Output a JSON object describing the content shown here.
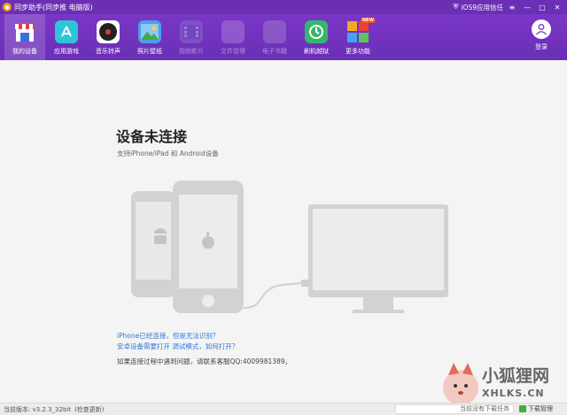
{
  "titlebar": {
    "title": "同步助手(同步推 电脑版)",
    "trust_label": "iOS9应用信任",
    "minimize": "—",
    "maximize": "□",
    "close": "✕"
  },
  "nav": {
    "items": [
      {
        "label": "我的设备",
        "icon": "device-icon"
      },
      {
        "label": "应用游戏",
        "icon": "app-store-icon"
      },
      {
        "label": "音乐铃声",
        "icon": "music-icon"
      },
      {
        "label": "照片壁纸",
        "icon": "photo-icon"
      },
      {
        "label": "视频影片",
        "icon": "video-icon"
      },
      {
        "label": "文件管理",
        "icon": "folder-icon"
      },
      {
        "label": "电子书籍",
        "icon": "book-icon"
      },
      {
        "label": "刷机越狱",
        "icon": "flash-icon"
      },
      {
        "label": "更多功能",
        "icon": "more-icon"
      }
    ],
    "new_badge": "NEW",
    "login_label": "登录"
  },
  "main": {
    "heading": "设备未连接",
    "subheading": "支持iPhone/iPad 和 Android设备",
    "link1": "iPhone已经连接，但是无法识别？",
    "link2": "安卓设备需要打开 调试模式，如何打开？",
    "note": "如果连接过程中遇到问题，请联系客服QQ:4009981389。"
  },
  "status": {
    "version": "当前版本: v3.2.3_32bit",
    "check_update": "(检查更新)",
    "task": "当前没有下载任务",
    "download_manager": "下载管理"
  },
  "watermark": {
    "cn": "小狐狸网",
    "en": "XHLKS.CN"
  },
  "colors": {
    "toolbar": "#6a2fb6",
    "link": "#2f7ad4",
    "illustration": "#d2d2d2"
  }
}
